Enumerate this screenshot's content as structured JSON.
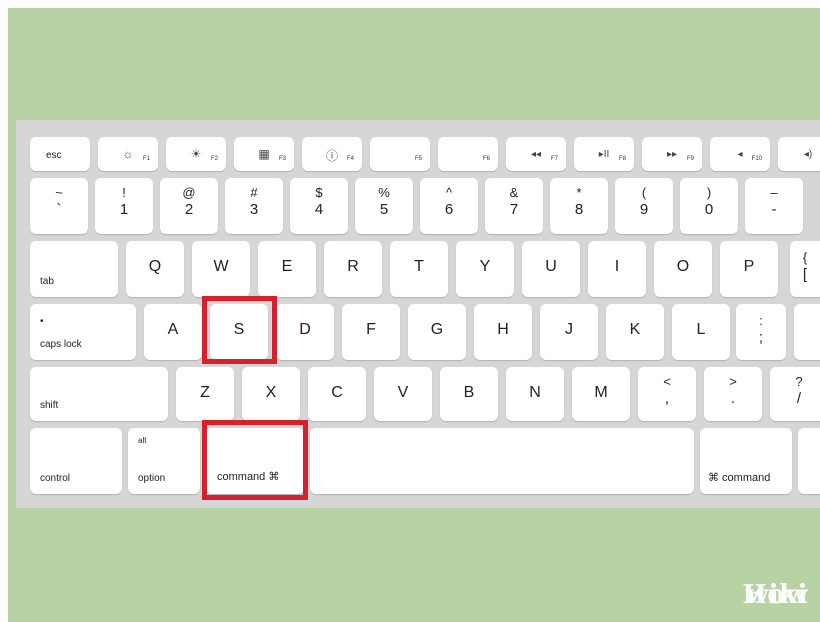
{
  "function_row": {
    "esc": "esc",
    "keys": [
      {
        "glyph": "☼",
        "sub": "F1",
        "icon": "brightness-down-icon"
      },
      {
        "glyph": "☀",
        "sub": "F2",
        "icon": "brightness-up-icon"
      },
      {
        "glyph": "▦",
        "sub": "F3",
        "icon": "mission-control-icon"
      },
      {
        "glyph": "ⓘ",
        "sub": "F4",
        "icon": "dashboard-icon"
      },
      {
        "glyph": "",
        "sub": "F5",
        "icon": "blank-icon"
      },
      {
        "glyph": "",
        "sub": "F6",
        "icon": "blank-icon"
      },
      {
        "glyph": "◂◂",
        "sub": "F7",
        "icon": "rewind-icon"
      },
      {
        "glyph": "▸II",
        "sub": "F8",
        "icon": "play-pause-icon"
      },
      {
        "glyph": "▸▸",
        "sub": "F9",
        "icon": "fast-forward-icon"
      },
      {
        "glyph": "◂",
        "sub": "F10",
        "icon": "mute-icon"
      },
      {
        "glyph": "◂)",
        "sub": "",
        "icon": "volume-down-icon"
      }
    ]
  },
  "number_row": [
    {
      "top": "~",
      "bottom": "`"
    },
    {
      "top": "!",
      "bottom": "1"
    },
    {
      "top": "@",
      "bottom": "2"
    },
    {
      "top": "#",
      "bottom": "3"
    },
    {
      "top": "$",
      "bottom": "4"
    },
    {
      "top": "%",
      "bottom": "5"
    },
    {
      "top": "^",
      "bottom": "6"
    },
    {
      "top": "&",
      "bottom": "7"
    },
    {
      "top": "*",
      "bottom": "8"
    },
    {
      "top": "(",
      "bottom": "9"
    },
    {
      "top": ")",
      "bottom": "0"
    },
    {
      "top": "–",
      "bottom": "-"
    }
  ],
  "qwerty_row": {
    "tab": "tab",
    "keys": [
      "Q",
      "W",
      "E",
      "R",
      "T",
      "Y",
      "U",
      "I",
      "O",
      "P"
    ],
    "bracket_top": "{",
    "bracket_bottom": "["
  },
  "home_row": {
    "caps": "caps lock",
    "caps_dot": "•",
    "keys": [
      "A",
      "S",
      "D",
      "F",
      "G",
      "H",
      "J",
      "K",
      "L"
    ],
    "semi_top": ":",
    "semi_bottom": ";"
  },
  "bottom_letter_row": {
    "shift": "shift",
    "keys": [
      "Z",
      "X",
      "C",
      "V",
      "B",
      "N",
      "M"
    ],
    "punct": [
      {
        "top": "<",
        "bottom": ","
      },
      {
        "top": ">",
        "bottom": "."
      },
      {
        "top": "?",
        "bottom": "/"
      }
    ]
  },
  "modifier_row": {
    "control": "control",
    "option_top": "alt",
    "option": "option",
    "command_left": "command ⌘",
    "command_right": "⌘ command"
  },
  "highlight_color": "#d6202f",
  "brand": {
    "part1": "wiki",
    "part2": "How"
  }
}
